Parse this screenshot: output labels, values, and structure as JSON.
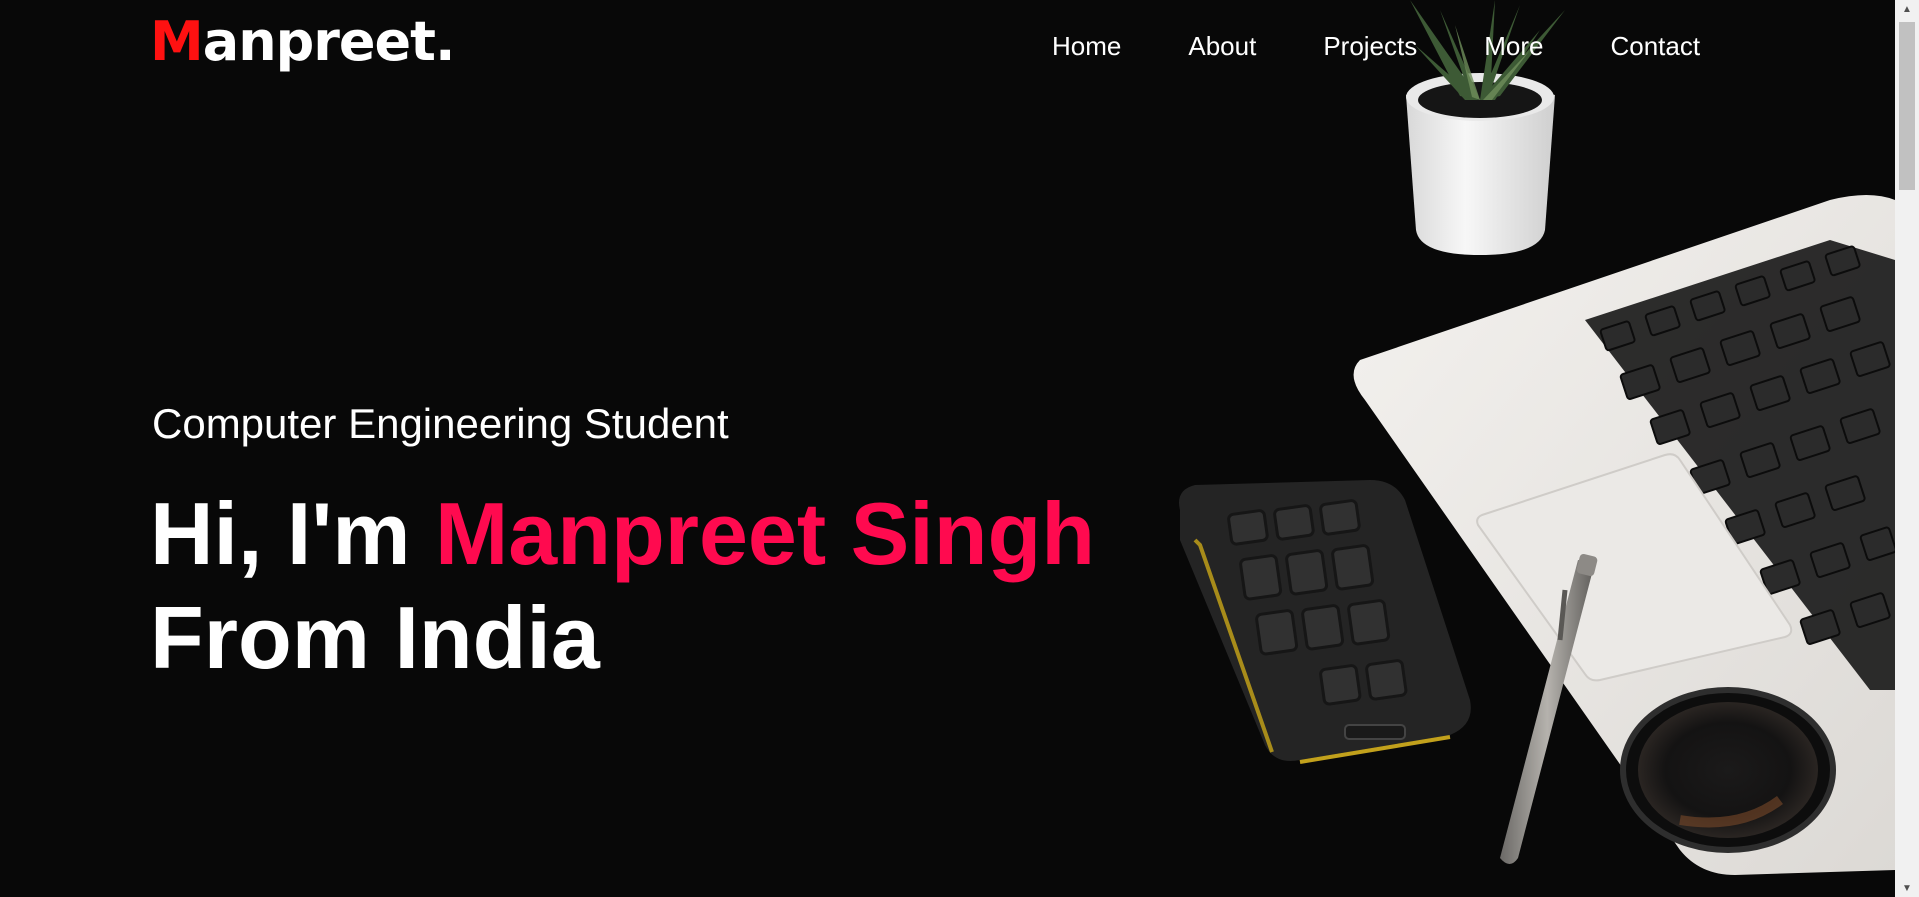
{
  "logo": {
    "first_letter": "M",
    "rest": "anpreet."
  },
  "nav": {
    "items": [
      {
        "label": "Home"
      },
      {
        "label": "About"
      },
      {
        "label": "Projects"
      },
      {
        "label": "More"
      },
      {
        "label": "Contact"
      }
    ]
  },
  "hero": {
    "subtitle": "Computer Engineering Student",
    "greeting": "Hi, I'm ",
    "name": "Manpreet Singh",
    "line2": "From India"
  },
  "colors": {
    "background": "#080808",
    "accent": "#ff0a4f",
    "logo_accent": "#ff1111",
    "text": "#ffffff"
  },
  "scrollbar": {
    "up_icon": "triangle-up-icon",
    "down_icon": "triangle-down-icon"
  }
}
